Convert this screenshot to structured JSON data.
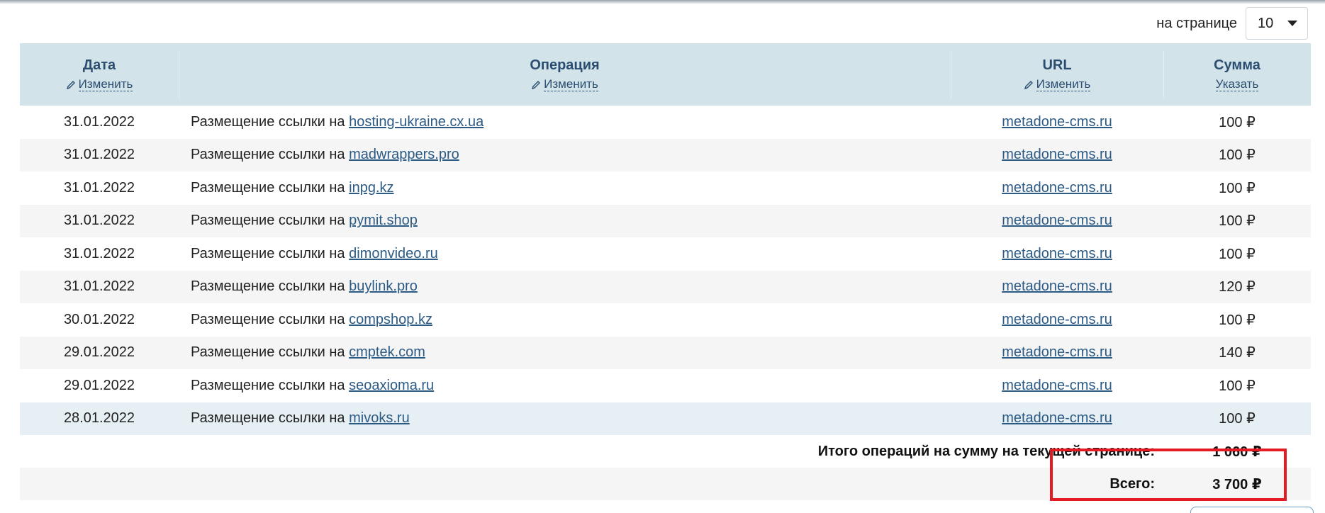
{
  "pager": {
    "label": "на странице",
    "value": "10"
  },
  "columns": [
    {
      "title": "Дата",
      "action": "Изменить",
      "has_icon": true
    },
    {
      "title": "Операция",
      "action": "Изменить",
      "has_icon": true
    },
    {
      "title": "URL",
      "action": "Изменить",
      "has_icon": true
    },
    {
      "title": "Сумма",
      "action": "Указать",
      "has_icon": false
    }
  ],
  "rows": [
    {
      "date": "31.01.2022",
      "op_prefix": "Размещение ссылки на",
      "op_link": "hosting-ukraine.cx.ua",
      "url": "metadone-cms.ru",
      "sum": "100 ₽"
    },
    {
      "date": "31.01.2022",
      "op_prefix": "Размещение ссылки на",
      "op_link": "madwrappers.pro",
      "url": "metadone-cms.ru",
      "sum": "100 ₽"
    },
    {
      "date": "31.01.2022",
      "op_prefix": "Размещение ссылки на",
      "op_link": "inpg.kz",
      "url": "metadone-cms.ru",
      "sum": "100 ₽"
    },
    {
      "date": "31.01.2022",
      "op_prefix": "Размещение ссылки на",
      "op_link": "pymit.shop",
      "url": "metadone-cms.ru",
      "sum": "100 ₽"
    },
    {
      "date": "31.01.2022",
      "op_prefix": "Размещение ссылки на",
      "op_link": "dimonvideo.ru",
      "url": "metadone-cms.ru",
      "sum": "100 ₽"
    },
    {
      "date": "31.01.2022",
      "op_prefix": "Размещение ссылки на",
      "op_link": "buylink.pro",
      "url": "metadone-cms.ru",
      "sum": "120 ₽"
    },
    {
      "date": "30.01.2022",
      "op_prefix": "Размещение ссылки на",
      "op_link": "compshop.kz",
      "url": "metadone-cms.ru",
      "sum": "100 ₽"
    },
    {
      "date": "29.01.2022",
      "op_prefix": "Размещение ссылки на",
      "op_link": "cmptek.com",
      "url": "metadone-cms.ru",
      "sum": "140 ₽"
    },
    {
      "date": "29.01.2022",
      "op_prefix": "Размещение ссылки на",
      "op_link": "seoaxioma.ru",
      "url": "metadone-cms.ru",
      "sum": "100 ₽"
    },
    {
      "date": "28.01.2022",
      "op_prefix": "Размещение ссылки на",
      "op_link": "mivoks.ru",
      "url": "metadone-cms.ru",
      "sum": "100 ₽"
    }
  ],
  "summary": {
    "page_label": "Итого операций на сумму на текущей странице:",
    "page_value": "1 060 ₽",
    "total_label": "Всего:",
    "total_value": "3 700 ₽"
  },
  "colors": {
    "header_bg": "#d2e3ea",
    "link": "#2b5a85",
    "highlight": "#e31b23"
  }
}
